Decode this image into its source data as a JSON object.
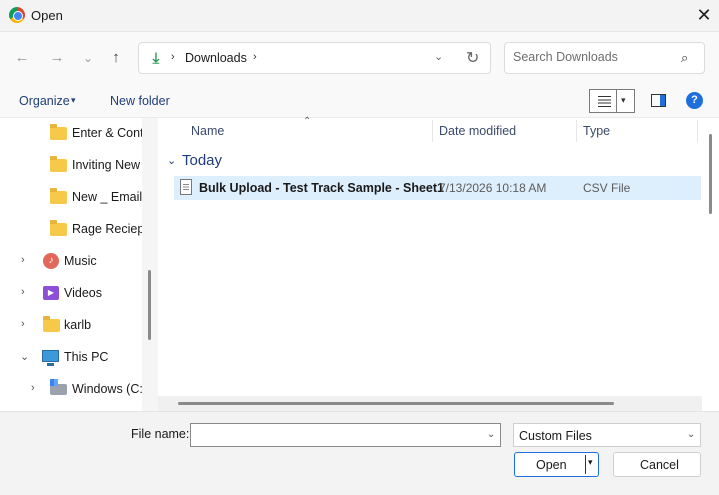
{
  "window": {
    "title": "Open",
    "app_icon": "chrome-icon",
    "close_glyph": "✕"
  },
  "nav": {
    "back_glyph": "←",
    "forward_glyph": "→",
    "recent_glyph": "⌄",
    "up_glyph": "↑",
    "address": {
      "location_icon": "download-icon",
      "icon_glyph": "⤓",
      "crumb": "Downloads",
      "sep_glyph": "›",
      "dropdown_glyph": "⌄",
      "refresh_glyph": "↻"
    },
    "search": {
      "placeholder": "Search Downloads",
      "icon_glyph": "⌕"
    }
  },
  "toolbar": {
    "organize": "Organize",
    "organize_caret": "▾",
    "new_folder": "New folder",
    "view_caret": "▾",
    "help_glyph": "?"
  },
  "sidebar": {
    "items": [
      {
        "label": "Enter & Conti",
        "icon": "folder-icon"
      },
      {
        "label": "Inviting New",
        "icon": "folder-icon"
      },
      {
        "label": "New _ Emails",
        "icon": "folder-icon"
      },
      {
        "label": "Rage Reciept",
        "icon": "folder-icon"
      },
      {
        "label": "Music",
        "icon": "music-icon",
        "glyph": "♪",
        "chevron": "›"
      },
      {
        "label": "Videos",
        "icon": "videos-icon",
        "glyph": "▶",
        "chevron": "›"
      },
      {
        "label": "karlb",
        "icon": "folder-icon",
        "chevron": "›"
      },
      {
        "label": "This PC",
        "icon": "pc-icon",
        "chevron": "⌄"
      },
      {
        "label": "Windows (C:",
        "icon": "drive-icon",
        "chevron": "›"
      }
    ]
  },
  "columns": {
    "name": "Name",
    "sort_glyph": "⌃",
    "date": "Date modified",
    "type": "Type"
  },
  "groups": [
    {
      "title": "Today",
      "chevron": "⌄",
      "files": [
        {
          "name": "Bulk Upload - Test Track Sample - Sheet1",
          "date": "7/13/2026 10:18 AM",
          "type": "CSV File"
        }
      ]
    }
  ],
  "footer": {
    "file_name_label": "File name:",
    "file_name_value": "",
    "dropdown_glyph": "⌄",
    "filter_value": "Custom Files",
    "open_label": "Open",
    "open_caret": "▾",
    "cancel_label": "Cancel"
  },
  "colors": {
    "accent": "#1e6fd9",
    "selection": "#ddeefc",
    "link": "#1f3d7a"
  }
}
